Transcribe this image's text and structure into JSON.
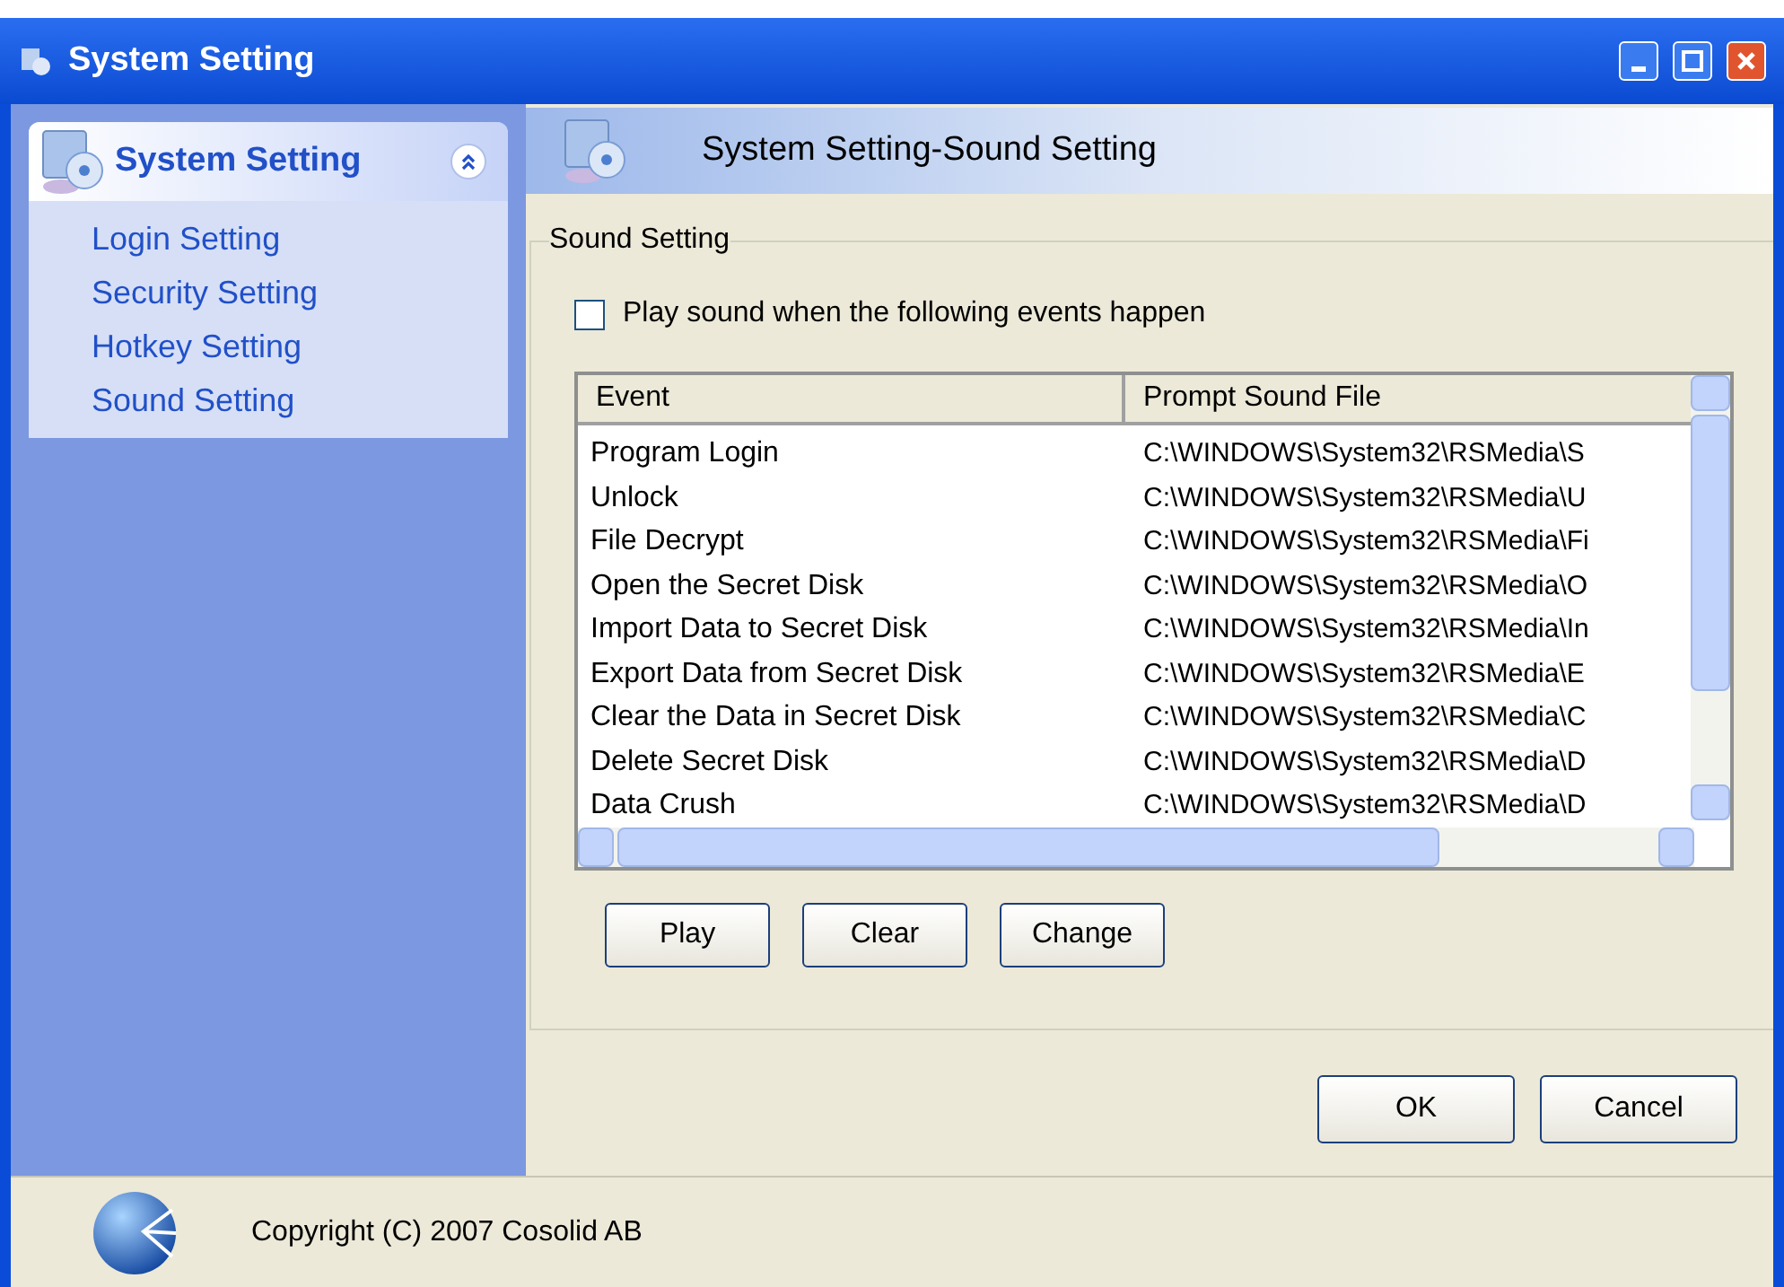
{
  "window": {
    "title": "System Setting"
  },
  "sidebar": {
    "title": "System Setting",
    "expanded": true,
    "items": [
      {
        "label": "Login Setting"
      },
      {
        "label": "Security Setting"
      },
      {
        "label": "Hotkey Setting"
      },
      {
        "label": "Sound Setting"
      }
    ]
  },
  "header": {
    "title": "System Setting-Sound Setting"
  },
  "group": {
    "title": "Sound Setting",
    "checkbox": {
      "label": "Play sound when the following events happen",
      "checked": false
    }
  },
  "table": {
    "columns": [
      "Event",
      "Prompt Sound File"
    ],
    "rows": [
      [
        "Program Login",
        "C:\\WINDOWS\\System32\\RSMedia\\S"
      ],
      [
        "Unlock",
        "C:\\WINDOWS\\System32\\RSMedia\\U"
      ],
      [
        "File Decrypt",
        "C:\\WINDOWS\\System32\\RSMedia\\Fi"
      ],
      [
        "Open the Secret Disk",
        "C:\\WINDOWS\\System32\\RSMedia\\O"
      ],
      [
        "Import Data to Secret Disk",
        "C:\\WINDOWS\\System32\\RSMedia\\In"
      ],
      [
        "Export Data from Secret Disk",
        "C:\\WINDOWS\\System32\\RSMedia\\E"
      ],
      [
        "Clear the Data in Secret Disk",
        "C:\\WINDOWS\\System32\\RSMedia\\C"
      ],
      [
        "Delete Secret Disk",
        "C:\\WINDOWS\\System32\\RSMedia\\D"
      ],
      [
        "Data Crush",
        "C:\\WINDOWS\\System32\\RSMedia\\D"
      ]
    ]
  },
  "table_buttons": [
    "Play",
    "Clear",
    "Change"
  ],
  "dialog_buttons": [
    "OK",
    "Cancel"
  ],
  "footer": {
    "copyright": "Copyright (C) 2007 Cosolid AB"
  }
}
